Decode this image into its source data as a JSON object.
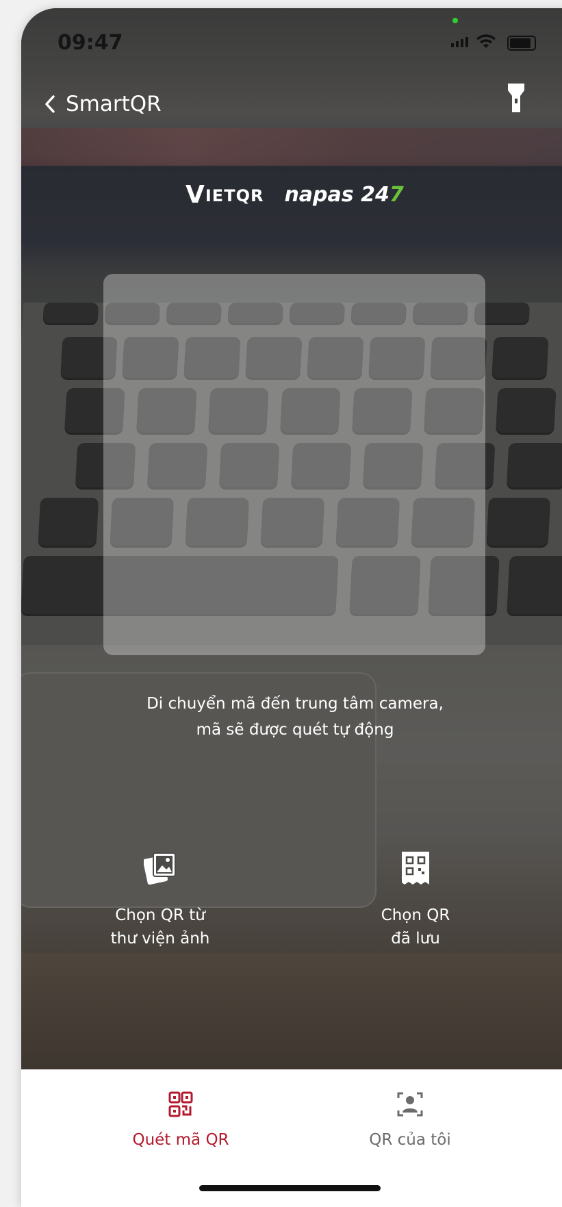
{
  "status_bar": {
    "time": "09:47"
  },
  "nav": {
    "back_label": "SmartQR"
  },
  "logos": {
    "vietqr_initial": "V",
    "vietqr_rest": "IETQR",
    "napas_text": "napas 24",
    "napas_accent": "7"
  },
  "hint": {
    "line1": "Di chuyển mã đến trung tâm camera,",
    "line2": "mã sẽ được quét tự động"
  },
  "actions": {
    "library": {
      "line1": "Chọn QR từ",
      "line2": "thư viện ảnh"
    },
    "saved": {
      "line1": "Chọn QR",
      "line2": "đã lưu"
    }
  },
  "tabs": [
    {
      "label": "Quét mã QR",
      "active": true
    },
    {
      "label": "QR của tôi",
      "active": false
    }
  ],
  "colors": {
    "accent": "#b3192d",
    "inactive": "#6b6b6b",
    "napas_green": "#6ac23a"
  }
}
